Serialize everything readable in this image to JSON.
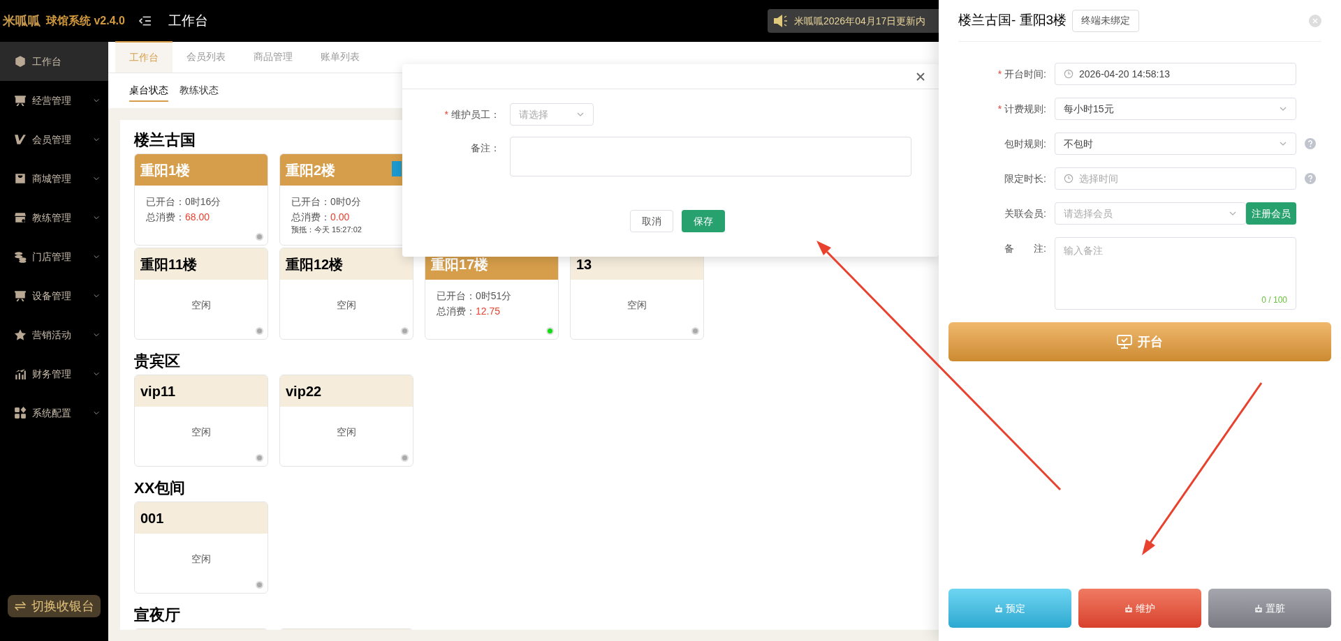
{
  "topbar": {
    "logo": "米呱呱",
    "product": "球馆系统 v2.4.0",
    "page_title": "工作台",
    "notice": "米呱呱2026年04月17日更新内"
  },
  "sidebar": {
    "items": [
      {
        "label": "工作台",
        "selected": true,
        "expandable": false
      },
      {
        "label": "经营管理",
        "selected": false,
        "expandable": true
      },
      {
        "label": "会员管理",
        "selected": false,
        "expandable": true
      },
      {
        "label": "商城管理",
        "selected": false,
        "expandable": true
      },
      {
        "label": "教练管理",
        "selected": false,
        "expandable": true
      },
      {
        "label": "门店管理",
        "selected": false,
        "expandable": true
      },
      {
        "label": "设备管理",
        "selected": false,
        "expandable": true
      },
      {
        "label": "营销活动",
        "selected": false,
        "expandable": true
      },
      {
        "label": "财务管理",
        "selected": false,
        "expandable": true
      },
      {
        "label": "系统配置",
        "selected": false,
        "expandable": true
      }
    ],
    "switch_button": "切换收银台"
  },
  "tabs": [
    {
      "label": "工作台",
      "selected": true
    },
    {
      "label": "会员列表",
      "selected": false
    },
    {
      "label": "商品管理",
      "selected": false
    },
    {
      "label": "账单列表",
      "selected": false
    }
  ],
  "subtabs": [
    {
      "label": "桌台状态",
      "selected": true
    },
    {
      "label": "教练状态",
      "selected": false
    }
  ],
  "sections": [
    {
      "title": "楼兰古国",
      "rows": [
        [
          {
            "kind": "open",
            "name": "重阳1楼",
            "open_label": "已开台：",
            "open_time": "0时16分",
            "cost_label": "总消费：",
            "cost": "68.00",
            "color": "#aaaaaa"
          },
          {
            "kind": "open",
            "name": "重阳2楼",
            "open_label": "已开台：",
            "open_time": "0时0分",
            "cost_label": "总消费：",
            "cost": "0.00",
            "reserve": "预抵：今天 15:27:02",
            "badge": true
          }
        ],
        [
          {
            "kind": "idle",
            "name": "重阳11楼",
            "status": "空闲",
            "color": "#aaaaaa"
          },
          {
            "kind": "idle",
            "name": "重阳12楼",
            "status": "空闲",
            "color": "#aaaaaa"
          },
          {
            "kind": "open",
            "name": "重阳17楼",
            "open_label": "已开台：",
            "open_time": "0时51分",
            "cost_label": "总消费：",
            "cost": "12.75",
            "color": "#11dd11"
          },
          {
            "kind": "idle",
            "name": "13",
            "status": "空闲",
            "color": "#aaaaaa"
          }
        ]
      ]
    },
    {
      "title": "贵宾区",
      "rows": [
        [
          {
            "kind": "idle",
            "name": "vip11",
            "status": "空闲",
            "color": "#aaaaaa"
          },
          {
            "kind": "idle",
            "name": "vip22",
            "status": "空闲",
            "color": "#aaaaaa"
          }
        ]
      ]
    },
    {
      "title": "XX包间",
      "rows": [
        [
          {
            "kind": "idle",
            "name": "001",
            "status": "空闲",
            "color": "#aaaaaa"
          }
        ]
      ]
    },
    {
      "title": "宣夜厅",
      "rows": [
        [
          {
            "kind": "idle"
          },
          {
            "kind": "idle"
          }
        ]
      ]
    }
  ],
  "modal": {
    "staff_label": "维护员工：",
    "staff_mark": "*",
    "staff_placeholder": "请选择",
    "note_label": "备注：",
    "cancel": "取消",
    "save": "保存"
  },
  "drawer": {
    "title": "楼兰古国- 重阳3楼",
    "terminal_tag": "终端未绑定",
    "fields": [
      {
        "kind": "time",
        "label": "开台时间:",
        "mark": "*",
        "value": "2026-04-20 14:58:13",
        "help": false
      },
      {
        "kind": "select",
        "label": "计费规则:",
        "mark": "*",
        "value": "每小时15元",
        "help": false
      },
      {
        "kind": "select",
        "label": "包时规则:",
        "value": "不包时",
        "help": true
      },
      {
        "kind": "time",
        "label": "限定时长:",
        "placeholder": "选择时间",
        "help": true
      },
      {
        "kind": "member",
        "label": "关联会员:",
        "placeholder": "请选择会员",
        "button": "注册会员",
        "help": false
      },
      {
        "kind": "textarea",
        "label": "备　　注:",
        "placeholder": "输入备注",
        "counter": "0 / 100",
        "help": false
      }
    ],
    "open_button": "开台",
    "actions": [
      {
        "label": "预定",
        "kind": "reserve"
      },
      {
        "label": "维护",
        "kind": "maintain"
      },
      {
        "label": "置脏",
        "kind": "dirty"
      }
    ]
  }
}
